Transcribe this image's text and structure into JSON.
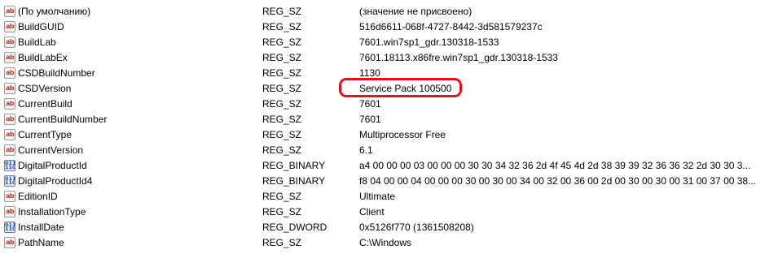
{
  "registry": {
    "rows": [
      {
        "icon": "string-value-icon",
        "glyph": "ab",
        "name": "(По умолчанию)",
        "type": "REG_SZ",
        "data": "(значение не присвоено)"
      },
      {
        "icon": "string-value-icon",
        "glyph": "ab",
        "name": "BuildGUID",
        "type": "REG_SZ",
        "data": "516d6611-068f-4727-8442-3d581579237c"
      },
      {
        "icon": "string-value-icon",
        "glyph": "ab",
        "name": "BuildLab",
        "type": "REG_SZ",
        "data": "7601.win7sp1_gdr.130318-1533"
      },
      {
        "icon": "string-value-icon",
        "glyph": "ab",
        "name": "BuildLabEx",
        "type": "REG_SZ",
        "data": "7601.18113.x86fre.win7sp1_gdr.130318-1533"
      },
      {
        "icon": "string-value-icon",
        "glyph": "ab",
        "name": "CSDBuildNumber",
        "type": "REG_SZ",
        "data": "1130"
      },
      {
        "icon": "string-value-icon",
        "glyph": "ab",
        "name": "CSDVersion",
        "type": "REG_SZ",
        "data": "Service Pack 100500"
      },
      {
        "icon": "string-value-icon",
        "glyph": "ab",
        "name": "CurrentBuild",
        "type": "REG_SZ",
        "data": "7601"
      },
      {
        "icon": "string-value-icon",
        "glyph": "ab",
        "name": "CurrentBuildNumber",
        "type": "REG_SZ",
        "data": "7601"
      },
      {
        "icon": "string-value-icon",
        "glyph": "ab",
        "name": "CurrentType",
        "type": "REG_SZ",
        "data": "Multiprocessor Free"
      },
      {
        "icon": "string-value-icon",
        "glyph": "ab",
        "name": "CurrentVersion",
        "type": "REG_SZ",
        "data": "6.1"
      },
      {
        "icon": "binary-value-icon",
        "glyph": "011\n110",
        "name": "DigitalProductId",
        "type": "REG_BINARY",
        "data": "a4 00 00 00 03 00 00 00 30 30 34 32 36 2d 4f 45 4d 2d 38 39 39 32 36 36 32 2d 30 30 3..."
      },
      {
        "icon": "binary-value-icon",
        "glyph": "011\n110",
        "name": "DigitalProductId4",
        "type": "REG_BINARY",
        "data": "f8 04 00 00 04 00 00 00 30 00 30 00 34 00 32 00 36 00 2d 00 30 00 30 00 31 00 37 00 38..."
      },
      {
        "icon": "string-value-icon",
        "glyph": "ab",
        "name": "EditionID",
        "type": "REG_SZ",
        "data": "Ultimate"
      },
      {
        "icon": "string-value-icon",
        "glyph": "ab",
        "name": "InstallationType",
        "type": "REG_SZ",
        "data": "Client"
      },
      {
        "icon": "binary-value-icon",
        "glyph": "011\n110",
        "name": "InstallDate",
        "type": "REG_DWORD",
        "data": "0x5126f770 (1361508208)"
      },
      {
        "icon": "string-value-icon",
        "glyph": "ab",
        "name": "PathName",
        "type": "REG_SZ",
        "data": "C:\\Windows"
      }
    ],
    "highlight_color": "#e3111c",
    "string_icon_color": "#c0392b",
    "binary_icon_color": "#1f4aa8"
  }
}
